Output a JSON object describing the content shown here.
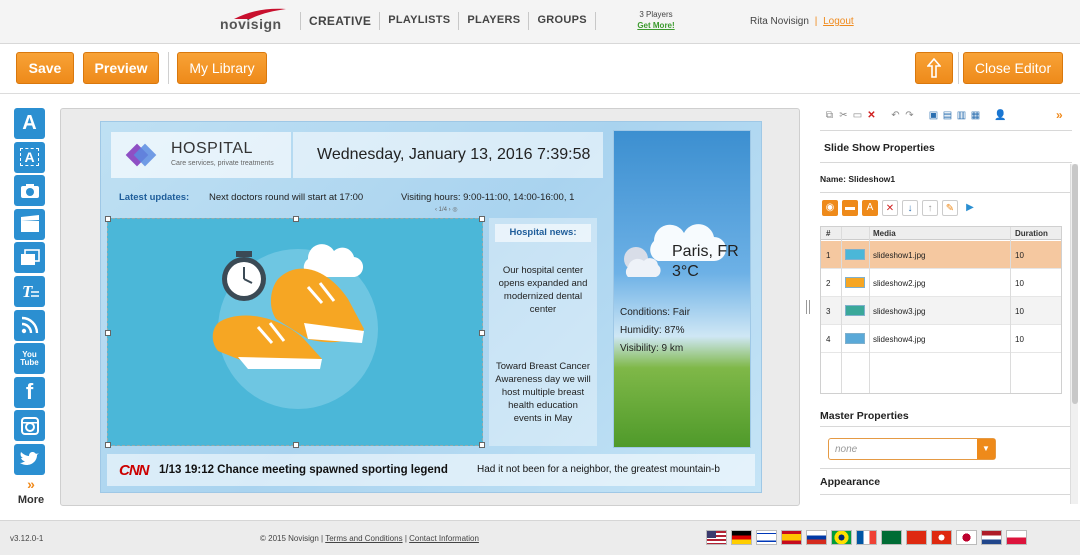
{
  "brand": {
    "logo_text": "novisign"
  },
  "nav": {
    "creative": "CREATIVE",
    "playlists": "PLAYLISTS",
    "players": "PLAYERS",
    "groups": "GROUPS"
  },
  "players_info": {
    "count": "3 Players",
    "get_more": "Get More!"
  },
  "user": {
    "name": "Rita Novisign",
    "separator": "|",
    "logout": "Logout"
  },
  "toolbar": {
    "save": "Save",
    "preview": "Preview",
    "my_library": "My Library",
    "upload_icon": "upload-arrow-icon",
    "close_editor": "Close Editor"
  },
  "tools": {
    "items": [
      "text-icon",
      "text-box-icon",
      "camera-icon",
      "video-clapper-icon",
      "slideshow-icon",
      "ticker-text-icon",
      "rss-icon",
      "youtube-icon",
      "facebook-icon",
      "instagram-icon",
      "twitter-icon"
    ],
    "labels": {
      "text": "A",
      "youtube": "You Tube",
      "facebook": "f",
      "more": "More",
      "more_chevron": "»"
    }
  },
  "slide": {
    "hospital_title": "HOSPITAL",
    "hospital_sub": "Care services, private treatments",
    "datetime": "Wednesday, January 13, 2016 7:39:58",
    "updates_label": "Latest updates:",
    "updates_msg": "Next doctors round will start at 17:00",
    "visiting": "Visiting hours: 9:00-11:00, 14:00-16:00, 1",
    "pager": "‹ 1/4 › ◎",
    "news_head": "Hospital news:",
    "news_1": "Our hospital center opens expanded and modernized dental center",
    "news_2": "Toward Breast Cancer Awareness day we will host multiple breast health education events in May",
    "weather_city": "Paris, FR",
    "weather_temp": "3°C",
    "weather_conditions": "Conditions:  Fair",
    "weather_humidity": "Humidity:  87%",
    "weather_visibility": "Visibility:  9 km",
    "ticker_source": "CNN",
    "ticker_headline": "1/13 19:12 Chance meeting spawned sporting legend",
    "ticker_story": "Had it not been for a neighbor, the greatest mountain-b"
  },
  "panel": {
    "title": "Slide Show Properties",
    "name_label": "Name:  Slideshow1",
    "columns": {
      "num": "#",
      "media": "Media",
      "duration": "Duration"
    },
    "rows": [
      {
        "num": "1",
        "media": "slideshow1.jpg",
        "duration": "10"
      },
      {
        "num": "2",
        "media": "slideshow2.jpg",
        "duration": "10"
      },
      {
        "num": "3",
        "media": "slideshow3.jpg",
        "duration": "10"
      },
      {
        "num": "4",
        "media": "slideshow4.jpg",
        "duration": "10"
      }
    ],
    "master_title": "Master Properties",
    "master_value": "none",
    "appearance_title": "Appearance",
    "expand": "»"
  },
  "footer": {
    "version": "v3.12.0-1",
    "copyright": "© 2015 Novisign |",
    "terms": "Terms and Conditions",
    "sep": "|",
    "contact": "Contact Information",
    "flags": [
      "flag-us",
      "flag-de",
      "flag-il",
      "flag-es",
      "flag-ru",
      "flag-br",
      "flag-fr",
      "flag-sa",
      "flag-cn",
      "flag-hk",
      "flag-jp",
      "flag-nl",
      "flag-pl"
    ]
  },
  "colors": {
    "accent_orange": "#ee8a1a",
    "tool_blue": "#2b8fd1",
    "selected_row": "#f5c8a0"
  }
}
